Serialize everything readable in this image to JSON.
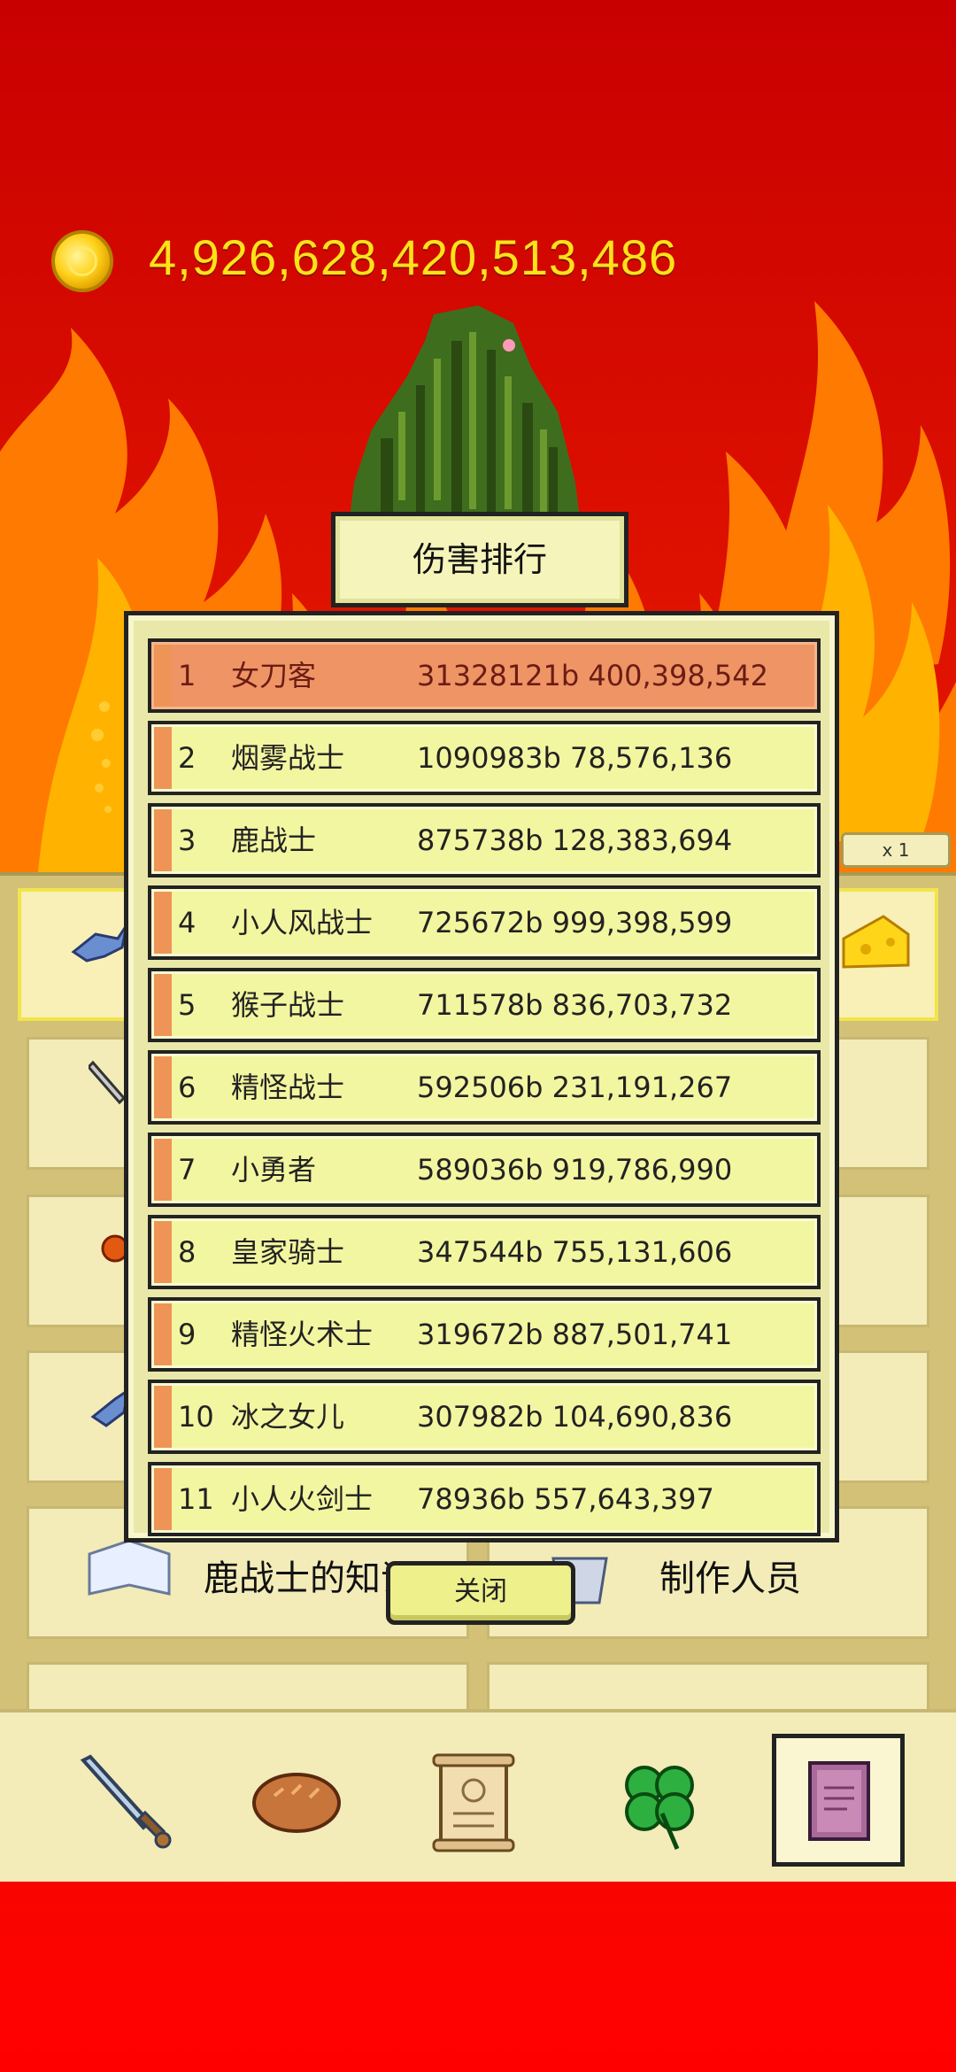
{
  "currency": {
    "amount": "4,926,628,420,513,486",
    "icon": "gold-coin-icon"
  },
  "multiplier": "x 1",
  "modal": {
    "title": "伤害排行",
    "close_label": "关闭",
    "rows": [
      {
        "rank": "1",
        "name": "女刀客",
        "damage": "31328121b 400,398,542"
      },
      {
        "rank": "2",
        "name": "烟雾战士",
        "damage": "1090983b 78,576,136"
      },
      {
        "rank": "3",
        "name": "鹿战士",
        "damage": "875738b 128,383,694"
      },
      {
        "rank": "4",
        "name": "小人风战士",
        "damage": "725672b 999,398,599"
      },
      {
        "rank": "5",
        "name": "猴子战士",
        "damage": "711578b 836,703,732"
      },
      {
        "rank": "6",
        "name": "精怪战士",
        "damage": "592506b 231,191,267"
      },
      {
        "rank": "7",
        "name": "小勇者",
        "damage": "589036b 919,786,990"
      },
      {
        "rank": "8",
        "name": "皇家骑士",
        "damage": "347544b 755,131,606"
      },
      {
        "rank": "9",
        "name": "精怪火术士",
        "damage": "319672b 887,501,741"
      },
      {
        "rank": "10",
        "name": "冰之女儿",
        "damage": "307982b 104,690,836"
      },
      {
        "rank": "11",
        "name": "小人火剑士",
        "damage": "78936b 557,643,397"
      }
    ]
  },
  "background_menu": {
    "knowledge_label": "鹿战士的知识",
    "credits_label": "制作人员"
  },
  "bottom_nav": [
    {
      "icon": "sword-icon"
    },
    {
      "icon": "bread-icon"
    },
    {
      "icon": "scroll-icon"
    },
    {
      "icon": "clover-icon"
    },
    {
      "icon": "book-icon",
      "active": true
    }
  ],
  "colors": {
    "coin_text": "#ffe21a",
    "row_bg": "#f3f6a0",
    "row_top_bg": "#ef9465",
    "accent_orange": "#ef9457"
  }
}
